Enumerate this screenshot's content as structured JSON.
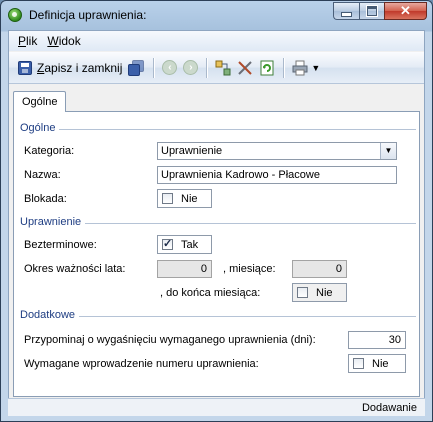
{
  "window": {
    "title": "Definicja uprawnienia:"
  },
  "menu": [
    {
      "label": "Plik",
      "underline": "P",
      "rest": "lik"
    },
    {
      "label": "Widok",
      "underline": "W",
      "rest": "idok"
    }
  ],
  "toolbar": {
    "save_close_underline": "Z",
    "save_close_rest": "apisz i zamknij",
    "icons": [
      "save-icon",
      "save-all-icon",
      "back-icon",
      "forward-icon",
      "components-icon",
      "tools-icon",
      "refresh-icon",
      "print-icon"
    ]
  },
  "tabs": [
    {
      "label": "Ogólne",
      "active": true
    }
  ],
  "groups": {
    "general": {
      "title": "Ogólne",
      "category_label": "Kategoria:",
      "category_value": "Uprawnienie",
      "name_label": "Nazwa:",
      "name_value": "Uprawnienia Kadrowo - Płacowe",
      "blocked_label": "Blokada:",
      "blocked_value": "Nie",
      "blocked_checked": false
    },
    "permission": {
      "title": "Uprawnienie",
      "indefinite_label": "Bezterminowe:",
      "indefinite_value": "Tak",
      "indefinite_checked": true,
      "validity_years_label": "Okres ważności lata:",
      "validity_years_value": "0",
      "months_label": ", miesiące:",
      "months_value": "0",
      "end_of_month_label": ", do końca miesiąca:",
      "end_of_month_value": "Nie",
      "end_of_month_checked": false
    },
    "additional": {
      "title": "Dodatkowe",
      "reminder_label": "Przypominaj o wygaśnięciu wymaganego uprawnienia (dni):",
      "reminder_value": "30",
      "require_number_label": "Wymagane wprowadzenie numeru uprawnienia:",
      "require_number_value": "Nie",
      "require_number_checked": false
    }
  },
  "status": {
    "mode": "Dodawanie"
  }
}
